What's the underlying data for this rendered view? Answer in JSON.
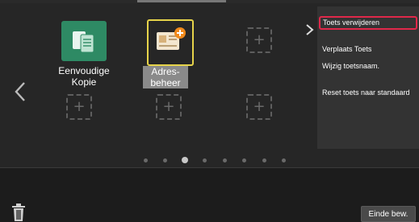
{
  "home": {
    "tiles": [
      {
        "label": "Eenvoudige\nKopie",
        "icon": "copy-icon"
      },
      {
        "label": "Adres-\nbeheer",
        "icon": "address-book-icon"
      }
    ],
    "page_count": 8,
    "current_page": 3
  },
  "context_menu": {
    "items": [
      {
        "label": "Toets verwijderen"
      },
      {
        "label": "Verplaats Toets"
      },
      {
        "label": "Wijzig toetsnaam."
      },
      {
        "label": "Reset toets naar standaard"
      }
    ]
  },
  "bottom": {
    "done_label": "Einde bew."
  },
  "colors": {
    "selection_highlight": "#e6d34a",
    "menu_selection": "#e0284a",
    "copy_tile": "#2e8a64"
  }
}
